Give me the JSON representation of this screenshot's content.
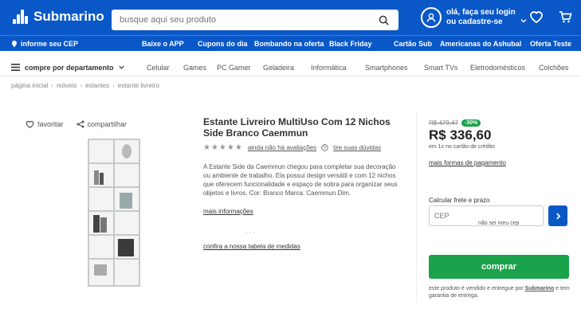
{
  "header": {
    "logo_text": "Submarino",
    "search_placeholder": "busque aqui seu produto",
    "account_line1": "olá, faça seu login",
    "account_line2": "ou cadastre-se",
    "accent": "#0a58c8"
  },
  "subbar": {
    "cep": "informe seu CEP",
    "links": [
      "Baixe o APP",
      "Cupons do dia",
      "Bombando na oferta",
      "Black Friday",
      "Cartão Sub",
      "Americanas do Ashubal",
      "Oferta Teste"
    ]
  },
  "nav": {
    "departments": "compre por departamento",
    "items": [
      "Celular",
      "Games",
      "PC Gamer",
      "Geladeira",
      "Informática",
      "Smartphones",
      "Smart TVs",
      "Eletrodomésticos",
      "Colchões"
    ]
  },
  "breadcrumb": [
    "página inicial",
    "móveis",
    "estantes",
    "estante livreiro"
  ],
  "actions": {
    "favorite": "favoritar",
    "share": "compartilhar"
  },
  "product": {
    "title": "Estante Livreiro MultiUso Com 12 Nichos Side Branco Caemmun",
    "stars": "★★★★★",
    "rating_text": "ainda não há avaliações",
    "questions_text": "tire suas dúvidas",
    "description": "A Estante Side da Caemmun chegou para completar sua decoração ou ambiente de trabalho. Ela possui design versátil e com 12 nichos que oferecem funcionalidade e espaço de sobra para organizar seus objetos e livros. Cor: Branco Marca: Caemmun Dim.",
    "more_link": "mais informações",
    "dots": "· · ·",
    "sizes_link": "confira a nossa tabela de medidas"
  },
  "pricing": {
    "old_price": "R$ 479,47",
    "discount_badge": "-30%",
    "price": "R$ 336,60",
    "price_note": "em 1x no cartão de crédito",
    "payment_link": "mais formas de pagamento",
    "cep_label": "Calcular frete e prazo",
    "cep_placeholder": "CEP",
    "cep_link": "não sei meu cep",
    "buy_label": "comprar",
    "seller_text": "este produto é vendido e entregue por",
    "seller_name": "Submarino",
    "seller_suffix": "e tem garantia de entrega."
  }
}
